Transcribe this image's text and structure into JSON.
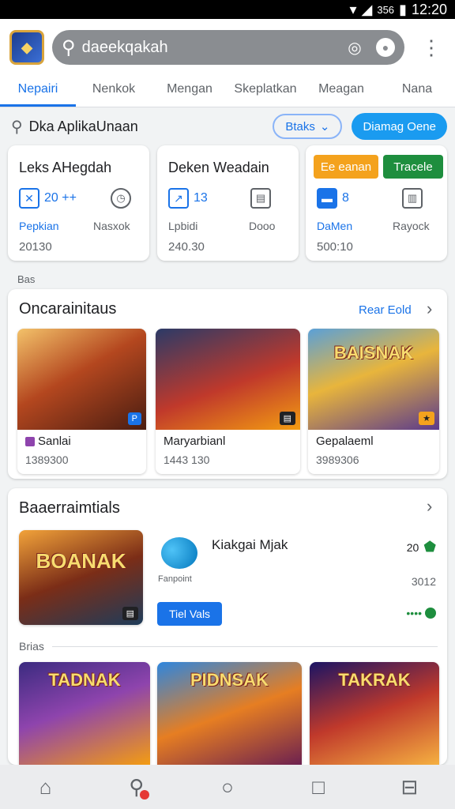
{
  "status": {
    "time": "12:20",
    "signal_text": "356"
  },
  "header": {
    "search_value": "daeekqakah",
    "icons": [
      "app-logo-icon",
      "search-icon",
      "voice-search-icon",
      "lens-icon",
      "more-vert-icon"
    ]
  },
  "tabs": [
    {
      "label": "Nepairi",
      "active": true
    },
    {
      "label": "Nenkok"
    },
    {
      "label": "Mengan"
    },
    {
      "label": "Skeplatkan"
    },
    {
      "label": "Meagan"
    },
    {
      "label": "Nana"
    }
  ],
  "search_row": {
    "text": "Dka AplikaUnaan",
    "filter_chip": "Btaks",
    "primary_chip": "Diamag Oene"
  },
  "stats": [
    {
      "title": "Leks AHegdah",
      "value": "20 ++",
      "label_blue": "Pepkian",
      "label": "Nasxok",
      "number": "20130"
    },
    {
      "title": "Deken Weadain",
      "value": "13",
      "label_blue": "Lpbidi",
      "label": "Dooo",
      "number": "240.30"
    },
    {
      "badge_orange": "Ee eanan",
      "badge_green": "Tracele",
      "value": "8",
      "label_blue": "DaMen",
      "label": "Rayock",
      "number": "500:10"
    }
  ],
  "small_section_label": "Bas",
  "section1": {
    "title": "Oncarainitaus",
    "link": "Rear Eold",
    "games": [
      {
        "name": "Sanlai",
        "meta": "1389300",
        "art_label": ""
      },
      {
        "name": "Maryarbianl",
        "meta": "1443 130",
        "art_label": ""
      },
      {
        "name": "Gepalaeml",
        "meta": "3989306",
        "art_label": "BAISNAK"
      }
    ]
  },
  "section2": {
    "title": "Baaerraimtials",
    "featured_art": "BOANAK",
    "promo_title": "Kiakgai Mjak",
    "promo_sub": "Fanpoint",
    "promo_button": "Tiel Vals",
    "right_top": "20",
    "right_mid": "3012",
    "right_bottom": "••••",
    "divider_label": "Brias",
    "games": [
      {
        "art_label": "TADNAK"
      },
      {
        "art_label": "PIDNSAK"
      },
      {
        "art_label": "TAKRAK"
      }
    ]
  },
  "nav": [
    "home-icon",
    "search-icon",
    "circle-icon",
    "square-icon",
    "profile-icon"
  ]
}
